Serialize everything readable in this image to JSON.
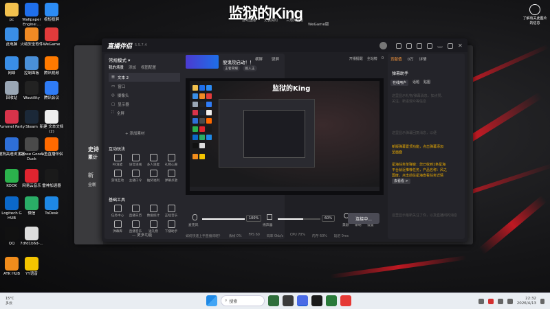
{
  "wallpaper": {
    "banner_title": "监狱的King",
    "banner_subs": [
      "游戏直播",
      "无畏契约",
      "三角洲行动"
    ],
    "wegame_caption": "WeGame版"
  },
  "desktop_icons": [
    {
      "label": "pc",
      "icon": "folder-icon",
      "color": "#f2c14e"
    },
    {
      "label": "Wallpaper Engine:...",
      "icon": "wallpaper-engine-icon",
      "color": "#1f6feb"
    },
    {
      "label": "极短投屏",
      "icon": "cast-icon",
      "color": "#2c8cf4"
    },
    {
      "label": "此电脑",
      "icon": "computer-icon",
      "color": "#3a8ee6"
    },
    {
      "label": "火绒安全软件",
      "icon": "shield-icon",
      "color": "#f08a24"
    },
    {
      "label": "WeGame",
      "icon": "wegame-icon",
      "color": "#e23b3b"
    },
    {
      "label": "网络",
      "icon": "network-icon",
      "color": "#3a8ee6"
    },
    {
      "label": "控制面板",
      "icon": "control-panel-icon",
      "color": "#4a90d9"
    },
    {
      "label": "腾讯视频",
      "icon": "video-icon",
      "color": "#ff7a00"
    },
    {
      "label": "回收站",
      "icon": "recycle-bin-icon",
      "color": "#9aa7b5"
    },
    {
      "label": "Wootility",
      "icon": "wootility-icon",
      "color": "#222222"
    },
    {
      "label": "腾讯会议",
      "icon": "meeting-icon",
      "color": "#2f7cf6"
    },
    {
      "label": "Pummel Party",
      "icon": "pummel-party-icon",
      "color": "#d8334a"
    },
    {
      "label": "Steam",
      "icon": "steam-icon",
      "color": "#1b2838"
    },
    {
      "label": "新建 文本文档 (2)",
      "icon": "text-file-icon",
      "color": "#eeeeee"
    },
    {
      "label": "搜狗高速浏览器",
      "icon": "browser-icon",
      "color": "#2e6fd8"
    },
    {
      "label": "Goose Goose Duck",
      "icon": "goose-icon",
      "color": "#4a4a4a"
    },
    {
      "label": "斗鱼直播伴侣",
      "icon": "douyu-icon",
      "color": "#ff6a00"
    },
    {
      "label": "KOOK",
      "icon": "kook-icon",
      "color": "#2bb24c"
    },
    {
      "label": "网易云音乐",
      "icon": "music-icon",
      "color": "#e0242f"
    },
    {
      "label": "雷神加速器",
      "icon": "thunder-icon",
      "color": "#1a1a1a"
    },
    {
      "label": "Logitech G HUB",
      "icon": "logitech-icon",
      "color": "#0b68c9"
    },
    {
      "label": "微信",
      "icon": "wechat-icon",
      "color": "#2aae67"
    },
    {
      "label": "ToDesk",
      "icon": "todesk-icon",
      "color": "#1e88e5"
    },
    {
      "label": "QQ",
      "icon": "qq-icon",
      "color": "#111111"
    },
    {
      "label": "7dfd1b6d-...",
      "icon": "file-icon",
      "color": "#dddddd"
    },
    {
      "label": "ATK HUB",
      "icon": "atk-icon",
      "color": "#f08c1c"
    },
    {
      "label": "YY语音",
      "icon": "yy-icon",
      "color": "#f3c400"
    }
  ],
  "right_desktop_icon": {
    "label": "了解有关此图片的信息",
    "icon": "info-camera-icon"
  },
  "bg_window": {
    "fragments": [
      "史诗",
      "累计",
      "新",
      "全新"
    ]
  },
  "app": {
    "name": "直播伴侣",
    "version": "5.5.7.4",
    "mode_label": "常规模式",
    "mode_actions": [
      "横屏",
      "竖屏"
    ],
    "scene_tabs": [
      "我的场景",
      "添加",
      "视图配置"
    ],
    "scenes": [
      "文本 2",
      "窗口",
      "摄像头",
      "显示器",
      "全屏"
    ],
    "add_source": "添加素材",
    "interactive_title": "互动玩法",
    "interactive_tools": [
      "PK连麦",
      "语音连线",
      "多人连麦",
      "礼物心愿",
      "游戏互动",
      "主播口令",
      "抽奖福利",
      "弹幕点歌"
    ],
    "basic_title": "基础工具",
    "basic_tools": [
      "任务中心",
      "直播日历",
      "数据统计",
      "正经音乐",
      "弹幕库",
      "直播音乐",
      "送礼物",
      "下播助手"
    ],
    "more_functions": "更多功能",
    "live_title": "股鬼院启动！！",
    "live_tags": [
      "王者荣耀",
      "路人王"
    ],
    "live_actions": [
      "开播提醒",
      "全站榜",
      "0"
    ],
    "preview_title": "监狱的King",
    "mic_label": "麦克风",
    "mic_value": 1.0,
    "mic_pct": "100%",
    "speaker_label": "扬声器",
    "speaker_value": 0.6,
    "speaker_pct": "60%",
    "bottom_tools": [
      "美颜",
      "录制",
      "设置"
    ],
    "start_button": "连接中...",
    "hint": "如何快速上手直播间呢？",
    "status": [
      "丢帧 0%",
      "FPS 60",
      "码率 0kb/s",
      "CPU 70%",
      "内存 60%",
      "延迟 0ms"
    ],
    "right_tabs": [
      "贡献值",
      "0万",
      "详情"
    ],
    "danmu_title": "弹幕助手",
    "danmu_subtabs": [
      "在线用户",
      "话题",
      "贴图"
    ],
    "danmu_msgs": [
      "这里显示礼物/弹幕消息，如点赞、",
      "关注、新进观众等信息",
      "这里显示弹幕回复消息，以便"
    ],
    "highlights": [
      "新版弹幕置顶功能，点击弹幕添加",
      "至画面",
      "星海任务单弹窗：您已收到1条星海",
      "平台就近推荐任务，产品名称：风之",
      "国度，点击前往星海查看任务详情"
    ],
    "view_btn": "去看看 >",
    "bottom_hint": "这里显示最新关注了你，以及直播间的消息"
  },
  "taskbar": {
    "weather_temp": "15°C",
    "weather_desc": "多云",
    "search_placeholder": "搜索",
    "time": "22:32",
    "date": "2026/4/13"
  }
}
